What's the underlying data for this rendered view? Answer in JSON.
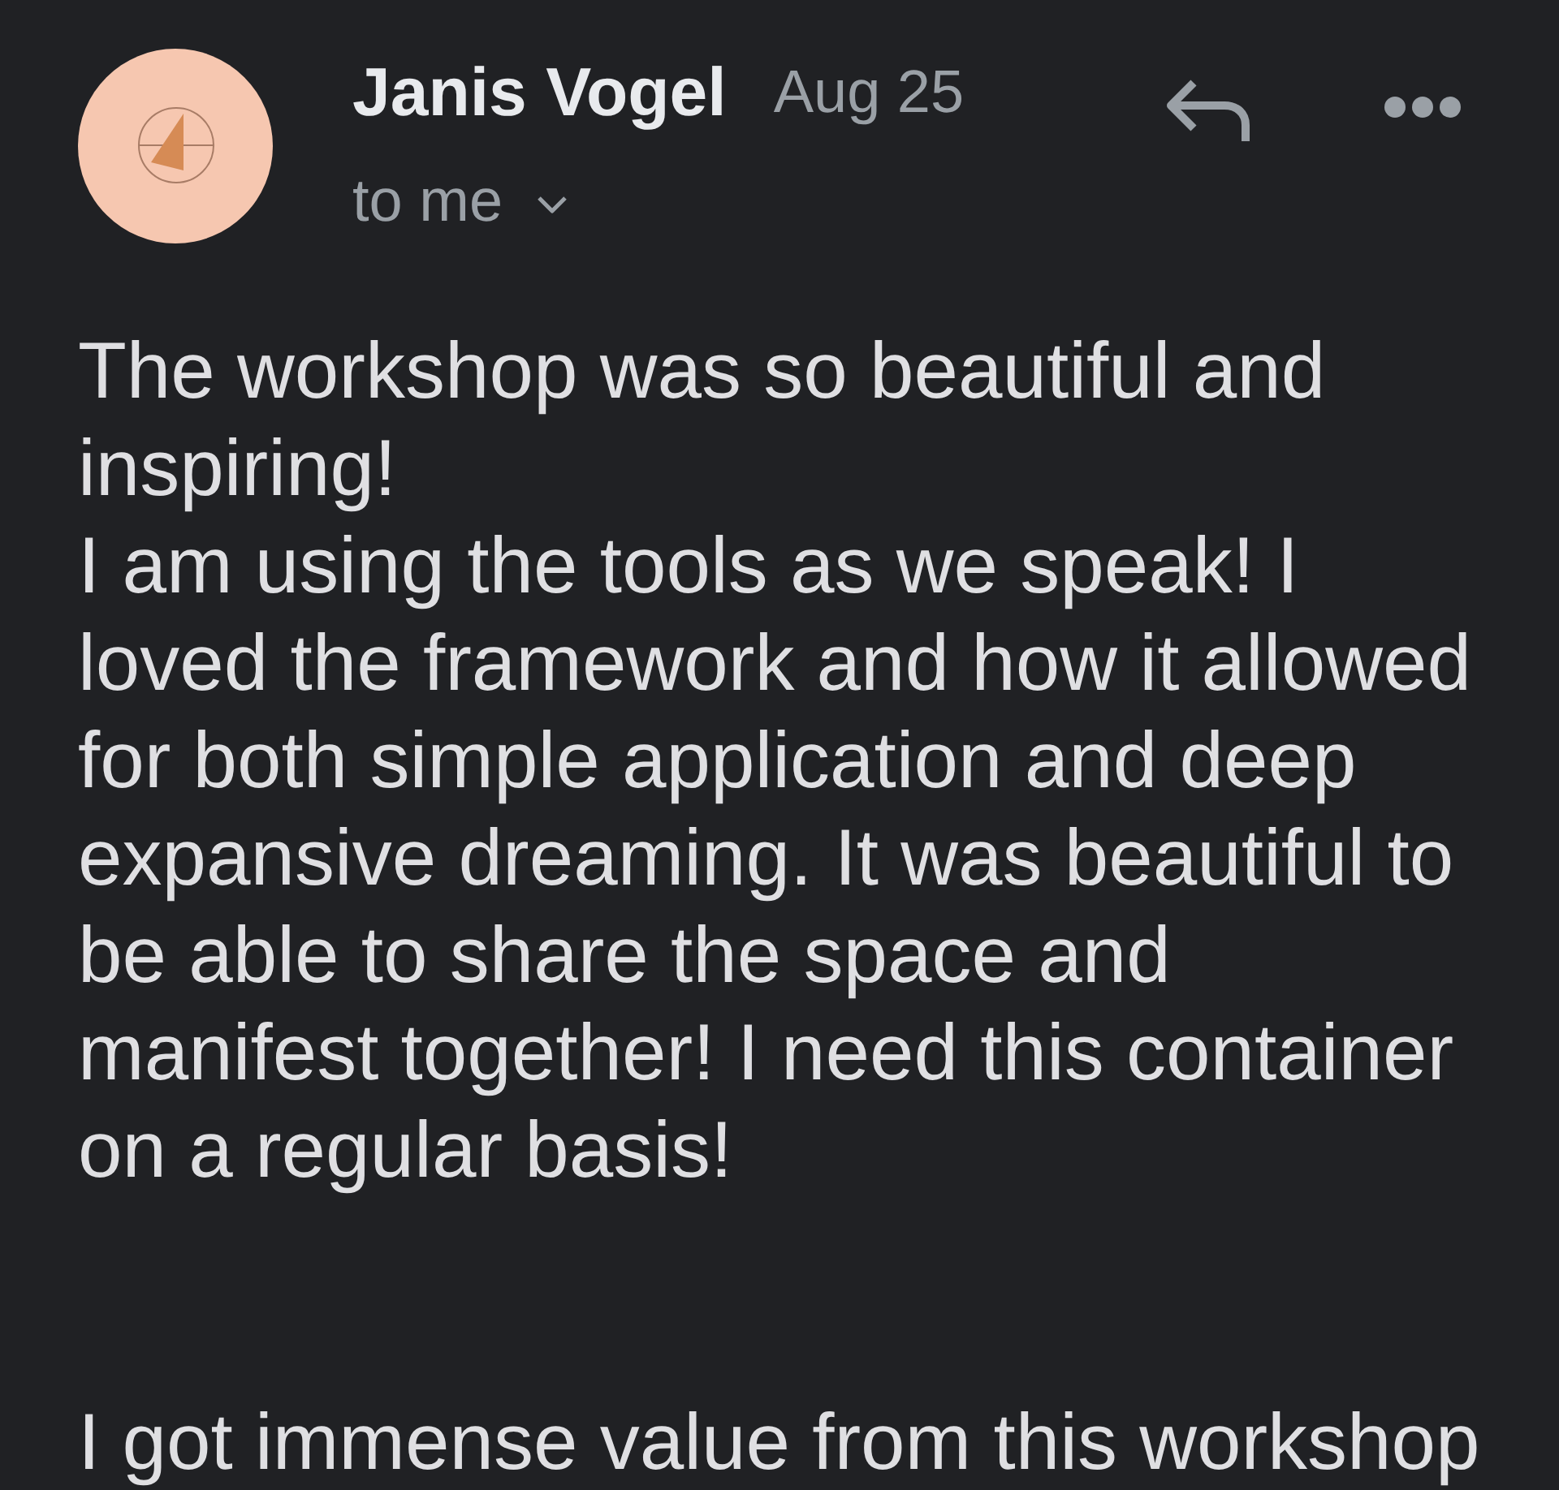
{
  "message": {
    "sender": "Janis Vogel",
    "date": "Aug 25",
    "recipient": "to me",
    "body": [
      {
        "lines": [
          "The workshop was so beautiful and inspiring!",
          "I am using the tools as we speak! I loved the framework and how it allowed for both simple application and deep expansive dreaming. It was beautiful to be able to share the space and manifest together! I need this container on a regular basis!"
        ]
      },
      {
        "lines": [
          "I got immense value from this workshop"
        ]
      }
    ]
  }
}
